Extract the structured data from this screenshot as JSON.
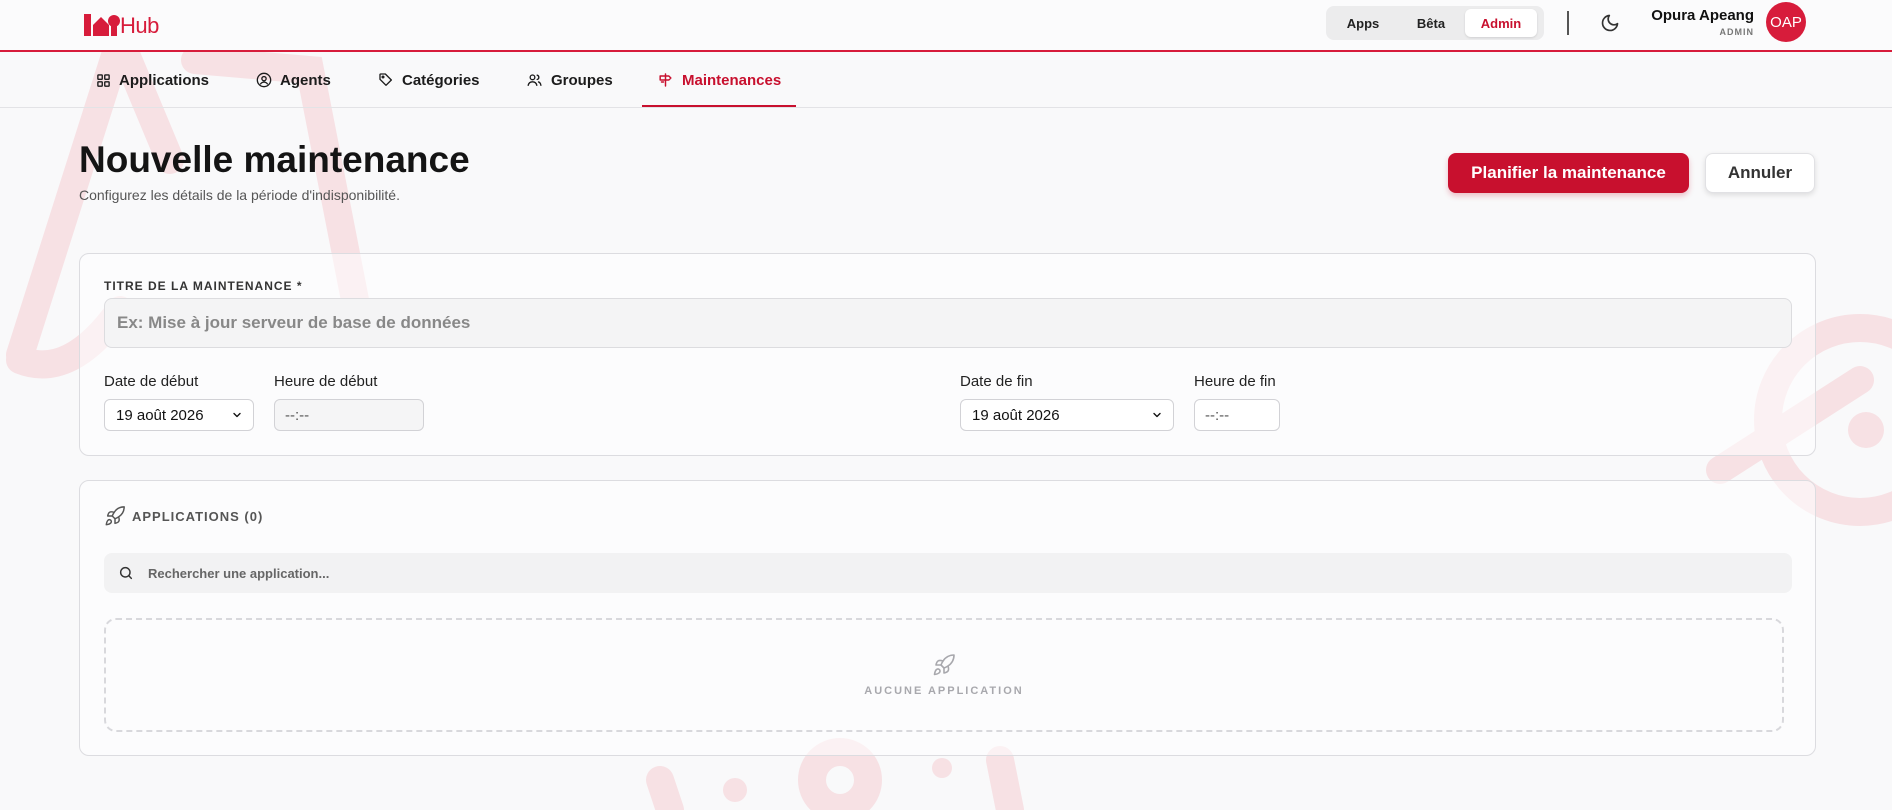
{
  "brand": {
    "logo_text": "Hub",
    "accent_color": "#c8102e"
  },
  "header": {
    "mode_switch": {
      "apps_label": "Apps",
      "beta_label": "Bêta",
      "admin_label": "Admin",
      "selected": "Admin"
    },
    "theme_icon": "moon-icon",
    "user": {
      "name": "Opura Apeang",
      "role": "ADMIN",
      "initials": "OAP"
    }
  },
  "nav": {
    "items": [
      {
        "label": "Applications",
        "icon": "grid-icon"
      },
      {
        "label": "Agents",
        "icon": "user-circle-icon"
      },
      {
        "label": "Catégories",
        "icon": "tags-icon"
      },
      {
        "label": "Groupes",
        "icon": "users-icon"
      },
      {
        "label": "Maintenances",
        "icon": "signpost-icon",
        "active": true
      }
    ]
  },
  "page": {
    "title": "Nouvelle maintenance",
    "subtitle": "Configurez les détails de la période d'indisponibilité.",
    "primary_action": "Planifier la maintenance",
    "secondary_action": "Annuler"
  },
  "form": {
    "title_label": "TITRE DE LA MAINTENANCE *",
    "title_placeholder": "Ex: Mise à jour serveur de base de données",
    "title_value": "",
    "start_date_label": "Date de début",
    "start_date_value": "19 août 2026",
    "start_time_label": "Heure de début",
    "start_time_value": "--:--",
    "end_date_label": "Date de fin",
    "end_date_value": "19 août 2026",
    "end_time_label": "Heure de fin",
    "end_time_value": "--:--"
  },
  "applications": {
    "header": "APPLICATIONS (0)",
    "header_icon": "rocket-icon",
    "search_placeholder": "Rechercher une application...",
    "empty_text": "AUCUNE APPLICATION"
  }
}
